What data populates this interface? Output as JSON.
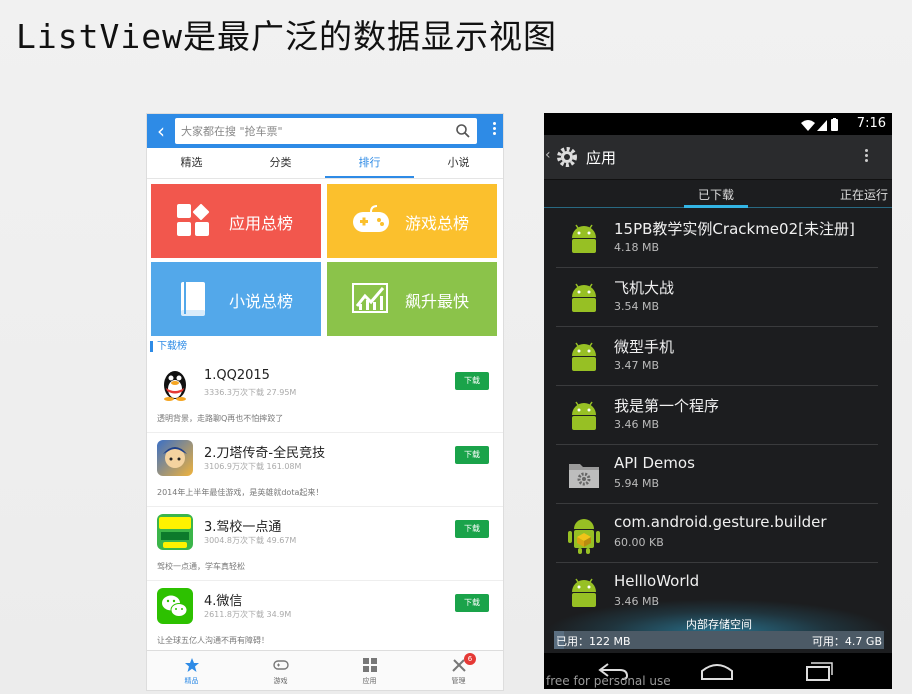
{
  "slide": {
    "title": "ListView是最广泛的数据显示视图"
  },
  "left_app": {
    "search_placeholder": "大家都在搜 \"抢车票\"",
    "tabs": [
      {
        "label": "精选"
      },
      {
        "label": "分类"
      },
      {
        "label": "排行",
        "active": true
      },
      {
        "label": "小说"
      }
    ],
    "tiles": [
      {
        "label": "应用总榜",
        "color": "#f2574d"
      },
      {
        "label": "游戏总榜",
        "color": "#fbc02d"
      },
      {
        "label": "小说总榜",
        "color": "#53a8ea"
      },
      {
        "label": "飙升最快",
        "color": "#8bc34a"
      }
    ],
    "section_label": "下载榜",
    "apps": [
      {
        "name": "1.QQ2015",
        "meta": "3336.3万次下载  27.95M",
        "desc": "透明背景，走路聊Q再也不怕摔跤了",
        "button": "下载"
      },
      {
        "name": "2.刀塔传奇-全民竞技",
        "meta": "3106.9万次下载  161.08M",
        "desc": "2014年上半年最佳游戏，是英雄就dota起来！",
        "button": "下载"
      },
      {
        "name": "3.驾校一点通",
        "meta": "3004.8万次下载  49.67M",
        "desc": "驾校一点通，学车真轻松",
        "button": "下载"
      },
      {
        "name": "4.微信",
        "meta": "2611.8万次下载  34.9M",
        "desc": "让全球五亿人沟通不再有障碍！",
        "button": "下载"
      }
    ],
    "bottom_nav": [
      {
        "label": "精品",
        "active": true
      },
      {
        "label": "游戏"
      },
      {
        "label": "应用"
      },
      {
        "label": "管理",
        "badge": "6"
      }
    ],
    "brand_color": "#2e8be6"
  },
  "right_app": {
    "status_time": "7:16",
    "title": "应用",
    "tabs": [
      {
        "label": "已下载",
        "active": true
      },
      {
        "label": "正在运行"
      }
    ],
    "apps": [
      {
        "name": "15PB教学实例Crackme02[未注册]",
        "size": "4.18 MB",
        "icon": "android-icon"
      },
      {
        "name": "飞机大战",
        "size": "3.54 MB",
        "icon": "android-icon"
      },
      {
        "name": "微型手机",
        "size": "3.47 MB",
        "icon": "android-icon"
      },
      {
        "name": "我是第一个程序",
        "size": "3.46 MB",
        "icon": "android-icon"
      },
      {
        "name": "API Demos",
        "size": "5.94 MB",
        "icon": "folder-gear-icon"
      },
      {
        "name": "com.android.gesture.builder",
        "size": "60.00 KB",
        "icon": "android-package-icon"
      },
      {
        "name": "HellloWorld",
        "size": "3.46 MB",
        "icon": "android-icon"
      }
    ],
    "storage": {
      "title": "内部存储空间",
      "used": "已用：122 MB",
      "free": "可用：4.7 GB"
    },
    "accent_color": "#33b5e5"
  },
  "watermark": "free for personal use"
}
